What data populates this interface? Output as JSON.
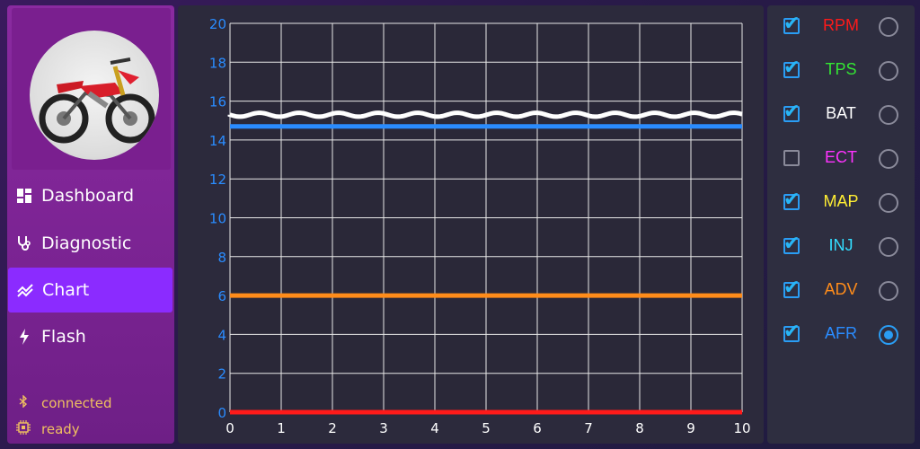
{
  "sidebar": {
    "items": [
      {
        "label": "Dashboard",
        "icon": "dashboard-icon"
      },
      {
        "label": "Diagnostic",
        "icon": "stethoscope-icon"
      },
      {
        "label": "Chart",
        "icon": "chart-icon",
        "active": true
      },
      {
        "label": "Flash",
        "icon": "flash-icon"
      }
    ],
    "status": [
      {
        "label": "connected",
        "icon": "bluetooth-icon"
      },
      {
        "label": "ready",
        "icon": "chip-icon"
      }
    ]
  },
  "legend": {
    "items": [
      {
        "label": "RPM",
        "color": "#ff1a1a",
        "checked": true,
        "selected": false
      },
      {
        "label": "TPS",
        "color": "#33e633",
        "checked": true,
        "selected": false
      },
      {
        "label": "BAT",
        "color": "#ffffff",
        "checked": true,
        "selected": false
      },
      {
        "label": "ECT",
        "color": "#ff33ff",
        "checked": false,
        "selected": false
      },
      {
        "label": "MAP",
        "color": "#ffee33",
        "checked": true,
        "selected": false
      },
      {
        "label": "INJ",
        "color": "#33ddff",
        "checked": true,
        "selected": false
      },
      {
        "label": "ADV",
        "color": "#ff8c1a",
        "checked": true,
        "selected": false
      },
      {
        "label": "AFR",
        "color": "#2a8cff",
        "checked": true,
        "selected": true
      }
    ]
  },
  "chart_data": {
    "type": "line",
    "x_ticks": [
      "0",
      "1",
      "2",
      "3",
      "4",
      "5",
      "6",
      "7",
      "8",
      "9",
      "10"
    ],
    "y_ticks": [
      "0",
      "2",
      "4",
      "6",
      "8",
      "10",
      "12",
      "14",
      "16",
      "18",
      "20"
    ],
    "xlim": [
      0,
      10
    ],
    "ylim": [
      0,
      20
    ],
    "grid": true,
    "series": [
      {
        "name": "RPM",
        "color": "#ff1a1a",
        "style": "flat",
        "x": [
          0,
          10
        ],
        "y": [
          0,
          0
        ]
      },
      {
        "name": "ADV",
        "color": "#ff8c1a",
        "style": "flat",
        "x": [
          0,
          10
        ],
        "y": [
          6,
          6
        ]
      },
      {
        "name": "AFR",
        "color": "#2a8cff",
        "style": "flat",
        "x": [
          0,
          10
        ],
        "y": [
          14.7,
          14.7
        ]
      },
      {
        "name": "BAT",
        "color": "#ffffff",
        "style": "wavy",
        "x": [
          0,
          10
        ],
        "y": [
          15.3,
          15.3
        ]
      }
    ]
  }
}
